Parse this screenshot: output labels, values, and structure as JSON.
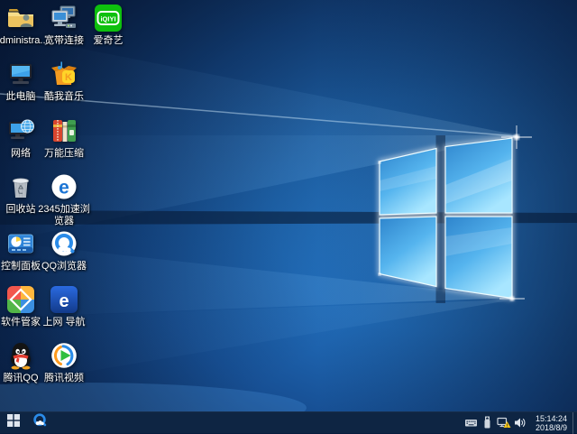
{
  "desktop": {
    "icons": [
      {
        "name": "administrator-folder",
        "label": "Administra..."
      },
      {
        "name": "broadband-connection",
        "label": "宽带连接"
      },
      {
        "name": "iqiyi",
        "label": "爱奇艺"
      },
      {
        "name": "this-pc",
        "label": "此电脑"
      },
      {
        "name": "kuwo-music",
        "label": "酷我音乐"
      },
      {
        "name": "network",
        "label": "网络"
      },
      {
        "name": "universal-zip",
        "label": "万能压缩"
      },
      {
        "name": "recycle-bin",
        "label": "回收站"
      },
      {
        "name": "2345-browser",
        "label": "2345加速浏览器"
      },
      {
        "name": "control-panel",
        "label": "控制面板"
      },
      {
        "name": "qq-browser",
        "label": "QQ浏览器"
      },
      {
        "name": "software-manager",
        "label": "软件管家"
      },
      {
        "name": "web-navigation",
        "label": "上网 导航"
      },
      {
        "name": "tencent-qq",
        "label": "腾讯QQ"
      },
      {
        "name": "tencent-video",
        "label": "腾讯视频"
      }
    ]
  },
  "glyphs": {
    "iqiyi_logo": "iQIYI",
    "kuwo_k": "K",
    "e_2345": "e",
    "e_webnav": "e",
    "network_warning": "!"
  },
  "taskbar": {
    "clock": {
      "time": "15:14:24",
      "date": "2018/8/9"
    },
    "tray": [
      "touch-keyboard",
      "usb-device",
      "network-warning",
      "volume"
    ]
  },
  "colors": {
    "wallpaper_accent": "#2e86d8",
    "wallpaper_deep": "#081c3e",
    "taskbar_bg": "#0e2543",
    "logo_pane_light": "#a8e6ff",
    "iqiyi_green": "#0ec00e",
    "qq_blue": "#2a8be8",
    "warning_yellow": "#f5c518"
  }
}
